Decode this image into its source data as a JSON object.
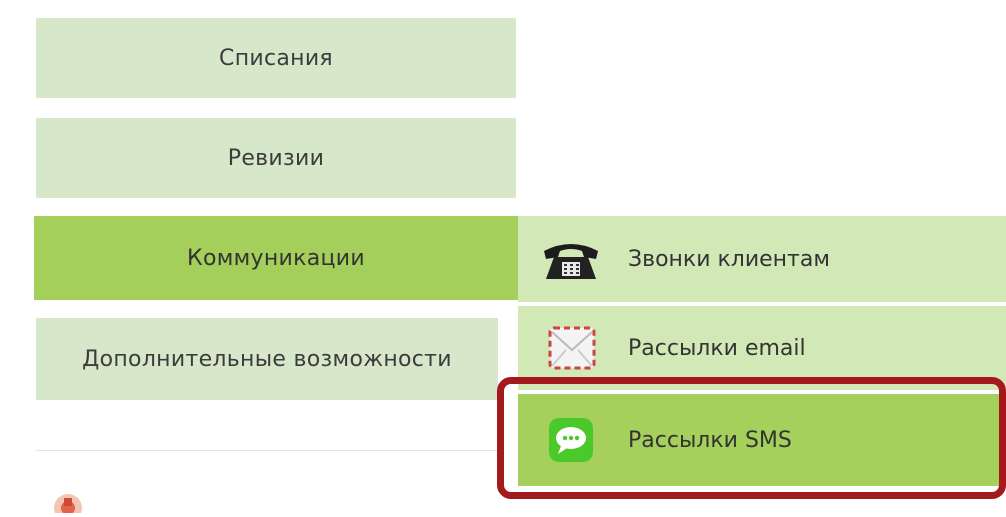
{
  "menu": {
    "items": [
      {
        "label": "Списания"
      },
      {
        "label": "Ревизии"
      },
      {
        "label": "Коммуникации"
      },
      {
        "label": "Дополнительные возможности"
      }
    ]
  },
  "submenu": {
    "items": [
      {
        "label": "Звонки клиентам",
        "icon": "telephone-icon"
      },
      {
        "label": "Рассылки email",
        "icon": "email-envelope-icon"
      },
      {
        "label": "Рассылки SMS",
        "icon": "sms-chat-bubble-icon"
      }
    ]
  },
  "colors": {
    "menu_light": "#d7e7c9",
    "menu_active": "#a3cf5a",
    "submenu_light": "#d2e8b6",
    "submenu_active": "#a5d05c",
    "highlight_border": "#a3191c",
    "sms_icon_green": "#4cc92a"
  }
}
